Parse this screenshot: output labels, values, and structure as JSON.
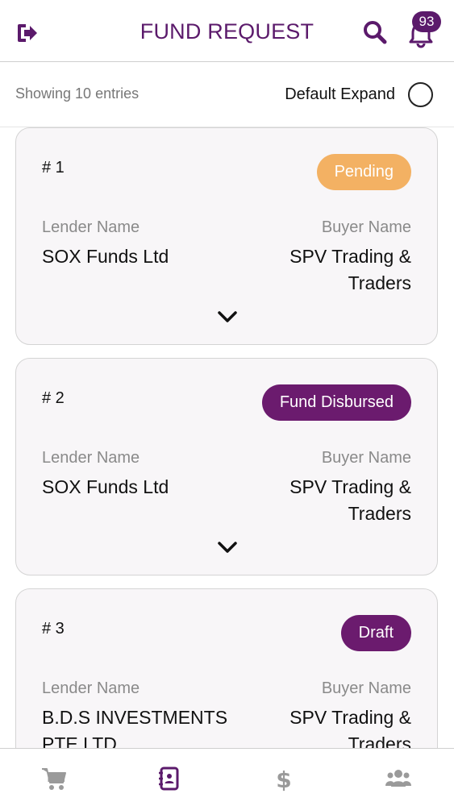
{
  "header": {
    "title": "FUND REQUEST",
    "notification_count": "93",
    "icons": {
      "logout": "logout-icon",
      "search": "search-icon",
      "bell": "bell-icon"
    }
  },
  "toolbar": {
    "showing_text": "Showing 10 entries",
    "default_expand_label": "Default Expand",
    "default_expand_checked": false
  },
  "fund_requests": [
    {
      "number": "# 1",
      "status": "Pending",
      "lender_label": "Lender Name",
      "lender_name": "SOX Funds Ltd",
      "buyer_label": "Buyer Name",
      "buyer_name": "SPV Trading & Traders"
    },
    {
      "number": "# 2",
      "status": "Fund Disbursed",
      "lender_label": "Lender Name",
      "lender_name": "SOX Funds Ltd",
      "buyer_label": "Buyer Name",
      "buyer_name": "SPV Trading & Traders"
    },
    {
      "number": "# 3",
      "status": "Draft",
      "lender_label": "Lender Name",
      "lender_name": "B.D.S INVESTMENTS PTE LTD",
      "buyer_label": "Buyer Name",
      "buyer_name": "SPV Trading & Traders"
    }
  ],
  "bottom_nav": [
    {
      "icon": "cart-icon",
      "active": false
    },
    {
      "icon": "contacts-icon",
      "active": true
    },
    {
      "icon": "dollar-icon",
      "active": false
    },
    {
      "icon": "users-icon",
      "active": false
    }
  ],
  "colors": {
    "brand": "#5b1a6b",
    "pending": "#f3b163",
    "disbursed": "#6b1b6e",
    "inactive_icon": "#9a9a9a"
  }
}
